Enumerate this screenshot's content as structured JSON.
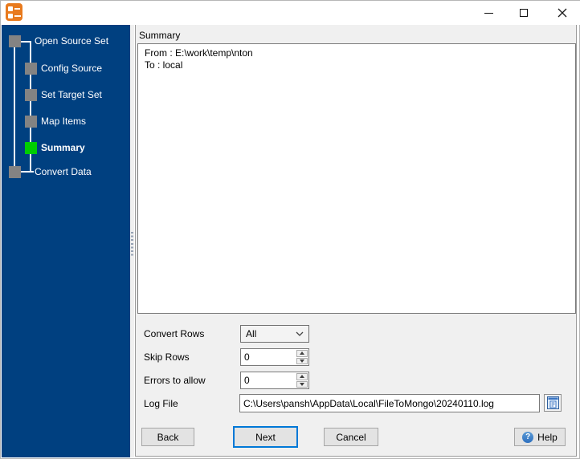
{
  "window": {
    "title": "",
    "controls": {
      "minimize": "minimize",
      "maximize": "maximize",
      "close": "close"
    },
    "app_icon_color": "#e87a1e"
  },
  "sidebar": {
    "colors": {
      "background": "#004080",
      "current_step": "#00ce00",
      "other_step": "#838383",
      "text": "#ffffff"
    },
    "steps": [
      {
        "label": "Open Source Set",
        "state": "done"
      },
      {
        "label": "Config Source",
        "state": "done"
      },
      {
        "label": "Set Target Set",
        "state": "done"
      },
      {
        "label": "Map Items",
        "state": "done"
      },
      {
        "label": "Summary",
        "state": "current"
      },
      {
        "label": "Convert Data",
        "state": "pending"
      }
    ]
  },
  "main": {
    "section_label": "Summary",
    "summary_box": {
      "lines": [
        "From : E:\\work\\temp\\nton",
        "To : local"
      ]
    },
    "form": {
      "convert_rows": {
        "label": "Convert Rows",
        "selected": "All"
      },
      "skip_rows": {
        "label": "Skip Rows",
        "value": "0"
      },
      "errors_to_allow": {
        "label": "Errors to allow",
        "value": "0"
      },
      "log_file": {
        "label": "Log File",
        "value": "C:\\Users\\pansh\\AppData\\Local\\FileToMongo\\20240110.log",
        "button_icon": "view-log-icon"
      }
    },
    "buttons": {
      "back": "Back",
      "next": "Next",
      "cancel": "Cancel",
      "help": "Help"
    },
    "accent": {
      "focus_border": "#0078d7",
      "help_icon": "#2e6fbf"
    }
  }
}
